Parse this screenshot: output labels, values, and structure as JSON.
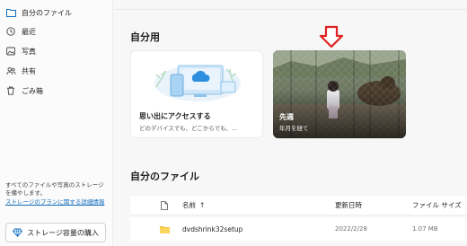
{
  "sidebar": {
    "items": [
      {
        "label": "自分のファイル",
        "icon": "folder-icon"
      },
      {
        "label": "最近",
        "icon": "clock-icon"
      },
      {
        "label": "写真",
        "icon": "image-icon"
      },
      {
        "label": "共有",
        "icon": "people-icon"
      },
      {
        "label": "ごみ箱",
        "icon": "trash-icon"
      }
    ],
    "storage_note": "すべてのファイルや写真のストレージを備やします。",
    "storage_link": "ストレージのプランに関する詳細情報",
    "buy_button": "ストレージ容量の購入"
  },
  "main": {
    "section_for_you": "自分用",
    "card_promo": {
      "title": "思い出にアクセスする",
      "subtitle": "どのデバイスでも、どこからでも、..."
    },
    "card_photo": {
      "title": "先週",
      "subtitle": "年月を経て"
    },
    "section_files": "自分のファイル",
    "table": {
      "columns": {
        "name": "名前",
        "sort_indicator": "↑",
        "modified": "更新日時",
        "size": "ファイル サイズ"
      },
      "rows": [
        {
          "name": "dvdshrink32setup",
          "modified": "2022/2/28",
          "size": "1.07 MB"
        }
      ]
    }
  },
  "colors": {
    "accent": "#0f6cbd",
    "arrow": "#e02020",
    "folder": "#f5c542"
  }
}
